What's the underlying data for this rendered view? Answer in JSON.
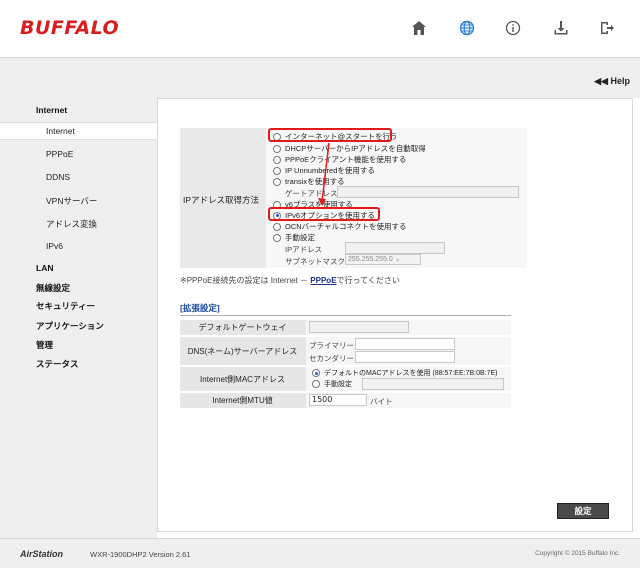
{
  "brand": {
    "logo": "BUFFALO",
    "logo_color": "#d81e1e"
  },
  "header_icons": [
    {
      "name": "home-icon"
    },
    {
      "name": "globe-icon",
      "active": true
    },
    {
      "name": "info-icon"
    },
    {
      "name": "download-icon"
    },
    {
      "name": "logout-icon"
    }
  ],
  "help_label": "◀◀ Help",
  "sidebar": {
    "internet_heading": "Internet",
    "items": [
      "Internet",
      "PPPoE",
      "DDNS",
      "VPNサーバー",
      "アドレス変換",
      "IPv6"
    ],
    "headings": [
      "LAN",
      "無線設定",
      "セキュリティー",
      "アプリケーション",
      "管理",
      "ステータス"
    ]
  },
  "ip_section": {
    "label": "IPアドレス取得方法",
    "options": [
      "インターネット@スタートを行う",
      "DHCPサーバーからIPアドレスを自動取得",
      "PPPoEクライアント機能を使用する",
      "IP Unnumberedを使用する",
      "transixを使用する",
      "v6プラスを使用する",
      "IPv6オプションを使用する",
      "OCNバーチャルコネクトを使用する",
      "手動設定"
    ],
    "selected_index": 6,
    "gateway_label": "ゲートアドレス",
    "ip_label": "IPアドレス",
    "subnet_label": "サブネットマスク",
    "subnet_value": "255.255.255.0"
  },
  "note": {
    "prefix": "※PPPoE接続先の設定は Internet － ",
    "link": "PPPoE",
    "suffix": "で行ってください"
  },
  "extended": {
    "title": "[拡張設定]",
    "default_gateway_label": "デフォルトゲートウェイ",
    "dns_label": "DNS(ネーム)サーバーアドレス",
    "primary_label": "プライマリー",
    "secondary_label": "セカンダリー",
    "mac_label": "Internet側MACアドレス",
    "mac_default": "デフォルトのMACアドレスを使用 (88:57:EE:7B:0B:7E)",
    "mac_manual": "手動設定",
    "mtu_label": "Internet側MTU値",
    "mtu_value": "1500",
    "mtu_unit": "バイト"
  },
  "settings_button": "設定",
  "footer": {
    "brand": "AirStation",
    "model": "WXR-1900DHP2  Version 2.61",
    "copyright": "Copyright © 2015 Buffalo Inc."
  },
  "colors": {
    "accent_blue": "#1a5fd0",
    "highlight_red": "#e01b1b"
  }
}
